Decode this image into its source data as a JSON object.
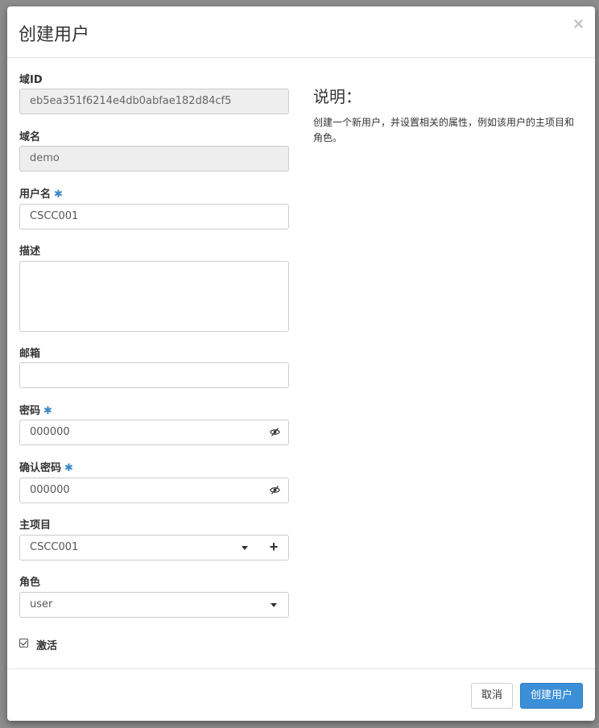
{
  "modal": {
    "title": "创建用户",
    "close_label": "×"
  },
  "form": {
    "domain_id": {
      "label": "域ID",
      "value": "eb5ea351f6214e4db0abfae182d84cf5"
    },
    "domain_name": {
      "label": "域名",
      "value": "demo"
    },
    "username": {
      "label": "用户名",
      "required_mark": "✱",
      "value": "CSCC001"
    },
    "description": {
      "label": "描述",
      "value": ""
    },
    "email": {
      "label": "邮箱",
      "value": ""
    },
    "password": {
      "label": "密码",
      "required_mark": "✱",
      "value": "000000"
    },
    "confirm_password": {
      "label": "确认密码",
      "required_mark": "✱",
      "value": "000000"
    },
    "primary_project": {
      "label": "主项目",
      "selected": "CSCC001",
      "add_label": "+"
    },
    "role": {
      "label": "角色",
      "selected": "user"
    },
    "enabled": {
      "label": "激活",
      "checked": true
    }
  },
  "help": {
    "title": "说明：",
    "text": "创建一个新用户，并设置相关的属性，例如该用户的主项目和角色。"
  },
  "footer": {
    "cancel_label": "取消",
    "submit_label": "创建用户"
  },
  "colors": {
    "primary": "#3b8fd6",
    "required": "#3a87c8",
    "readonly_bg": "#eeeeee"
  },
  "icons": {
    "password_toggle": "eye-slash-icon",
    "select": "caret-down-icon",
    "checkbox": "checkbox-checked-icon"
  }
}
